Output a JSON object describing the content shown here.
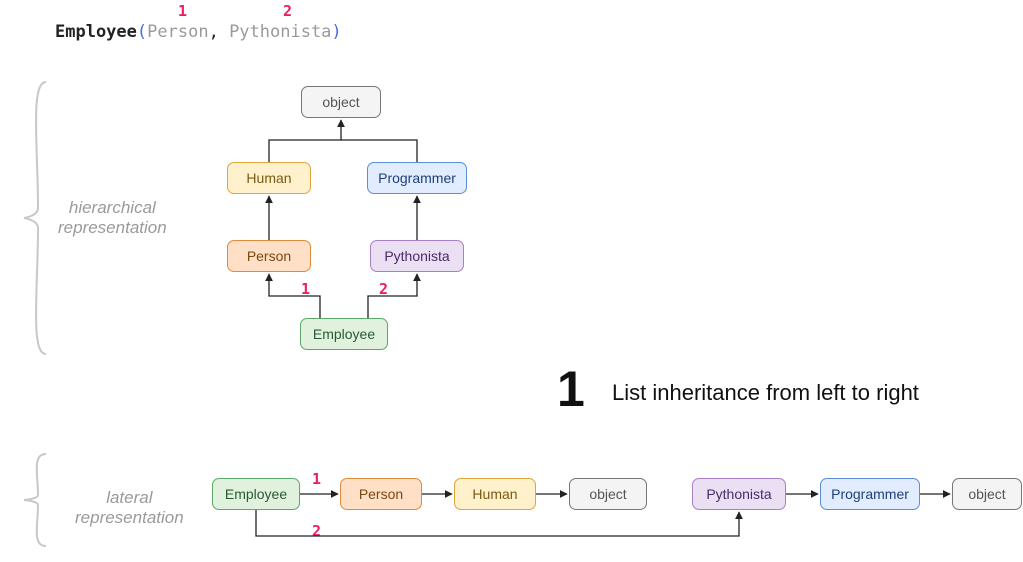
{
  "code": {
    "className": "Employee",
    "arg1": "Person",
    "arg2": "Pythonista",
    "anno1": "1",
    "anno2": "2"
  },
  "sections": {
    "hierarchical_line1": "hierarchical",
    "hierarchical_line2": "representation",
    "lateral_line1": "lateral",
    "lateral_line2": "representation"
  },
  "nodes": {
    "object": "object",
    "human": "Human",
    "programmer": "Programmer",
    "person": "Person",
    "pythonista": "Pythonista",
    "employee": "Employee"
  },
  "diagram_anno": {
    "h1": "1",
    "h2": "2",
    "l1": "1",
    "l2": "2"
  },
  "headline": {
    "num": "1",
    "text": "List inheritance from left to right"
  },
  "colors": {
    "accent": "#e91e63"
  }
}
